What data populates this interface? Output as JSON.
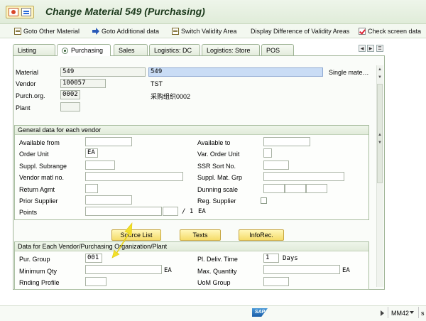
{
  "title": "Change Material 549 (Purchasing)",
  "toolbar": {
    "goto_other_material": "Goto Other Material",
    "goto_additional_data": "Goto Additional data",
    "switch_validity_area": "Switch Validity Area",
    "display_difference": "Display Difference of Validity Areas",
    "check_screen_data": "Check screen data"
  },
  "tabs": [
    "Listing",
    "Purchasing",
    "Sales",
    "Logistics: DC",
    "Logistics: Store",
    "POS"
  ],
  "active_tab": "Purchasing",
  "header": {
    "material_label": "Material",
    "material_value": "549",
    "material_desc": "549",
    "material_type_text": "Single mate…",
    "vendor_label": "Vendor",
    "vendor_value": "100057",
    "vendor_name": "TST",
    "purch_org_label": "Purch.org.",
    "purch_org_value": "0002",
    "purch_org_name": "采购组织0002",
    "plant_label": "Plant",
    "plant_value": ""
  },
  "general_group": {
    "title": "General data for each vendor",
    "available_from": "Available from",
    "available_to": "Available to",
    "order_unit": "Order Unit",
    "order_unit_value": "EA",
    "var_order_unit": "Var. Order Unit",
    "suppl_subrange": "Suppl. Subrange",
    "ssr_sort_no": "SSR Sort No.",
    "vendor_matl_no": "Vendor matl no.",
    "suppl_mat_grp": "Suppl. Mat. Grp",
    "return_agmt": "Return Agmt",
    "dunning_scale": "Dunning scale",
    "prior_supplier": "Prior Supplier",
    "reg_supplier": "Reg. Supplier",
    "points": "Points",
    "points_per": "/ 1",
    "points_unit": "EA"
  },
  "buttons": {
    "source_list": "Source List",
    "texts": "Texts",
    "inforec": "InfoRec."
  },
  "vendor_org_group": {
    "title": "Data for Each Vendor/Purchasing Organization/Plant",
    "pur_group": "Pur. Group",
    "pur_group_value": "001",
    "pl_deliv_time": "Pl. Deliv. Time",
    "pl_deliv_time_value": "1",
    "days": "Days",
    "minimum_qty": "Minimum Qty",
    "minimum_qty_unit": "EA",
    "max_quantity": "Max. Quantity",
    "max_quantity_unit": "EA",
    "rnding_profile": "Rnding Profile",
    "uom_group": "UoM Group"
  },
  "status": {
    "logo": "SAP",
    "tcode": "MM42",
    "extra": "s"
  },
  "colors": {
    "title_bar": "#e0ecd9",
    "button_yellow": "#f5dc6a",
    "annotation_arrow": "#f2e02a"
  }
}
